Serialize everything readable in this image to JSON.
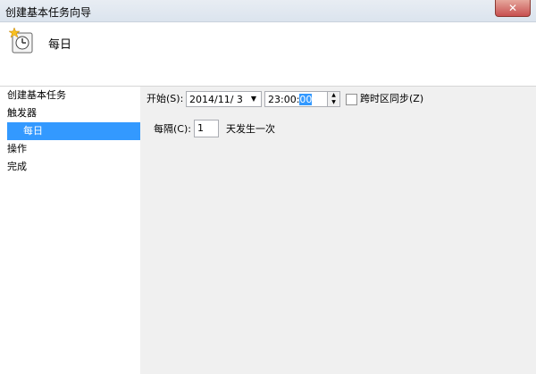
{
  "window": {
    "title": "创建基本任务向导",
    "close_glyph": "✕"
  },
  "header": {
    "title": "每日",
    "icon": "clock-star-icon"
  },
  "sidebar": {
    "items": [
      {
        "label": "创建基本任务"
      },
      {
        "label": "触发器"
      },
      {
        "label": "每日",
        "selected": true
      },
      {
        "label": "操作"
      },
      {
        "label": "完成"
      }
    ]
  },
  "trigger": {
    "start_label": "开始(S):",
    "date_value": "2014/11/  3",
    "time_prefix": "23:00:",
    "time_selected": "00",
    "sync_label": "跨时区同步(Z)",
    "sync_checked": false,
    "recur_label": "每隔(C):",
    "recur_value": "1",
    "recur_suffix": "天发生一次"
  }
}
